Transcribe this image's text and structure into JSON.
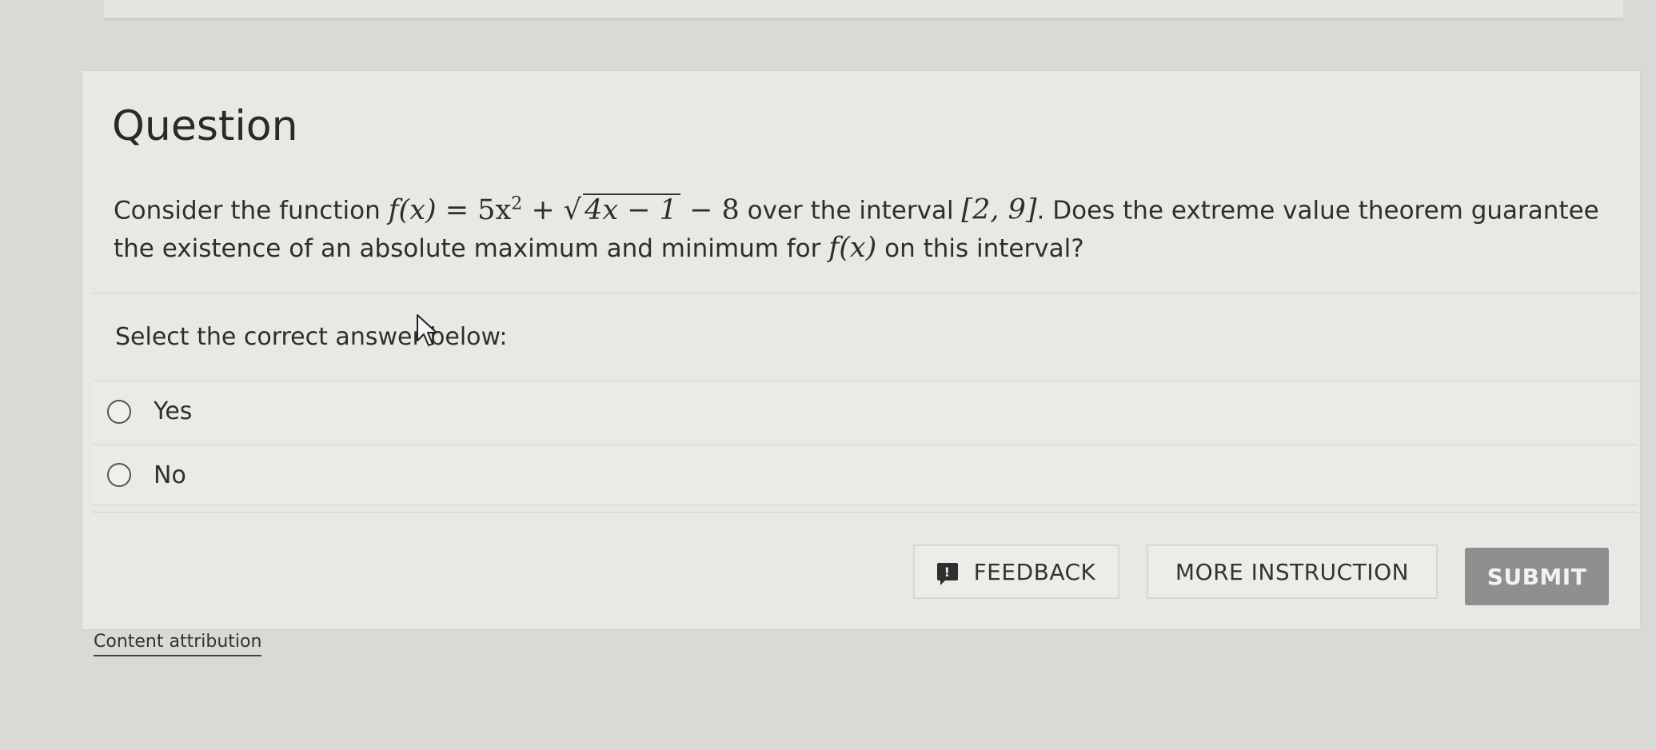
{
  "question": {
    "title": "Question",
    "prompt_before_fx": "Consider the function ",
    "prompt_over_interval": " over the interval ",
    "prompt_after_interval": ". Does the extreme value theorem guarantee the existence of an absolute maximum and minimum for ",
    "prompt_end": " on this interval?",
    "function_lhs": "f(x)",
    "function_eq": " = 5x",
    "function_exp": "2",
    "function_plus": " + ",
    "function_sqrt": "4x − 1",
    "function_minus": " − 8",
    "interval": "[2, 9]",
    "fx_ref": "f(x)"
  },
  "answers": {
    "label": "Select the correct answer below:",
    "options": [
      {
        "label": "Yes"
      },
      {
        "label": "No"
      }
    ]
  },
  "buttons": {
    "feedback": "FEEDBACK",
    "feedback_icon": "!",
    "more_instruction": "MORE INSTRUCTION",
    "submit": "SUBMIT"
  },
  "footer": {
    "attribution": "Content attribution"
  },
  "icons": {
    "feedback": "speech-bubble-exclamation-icon",
    "cursor": "mouse-pointer-icon"
  }
}
